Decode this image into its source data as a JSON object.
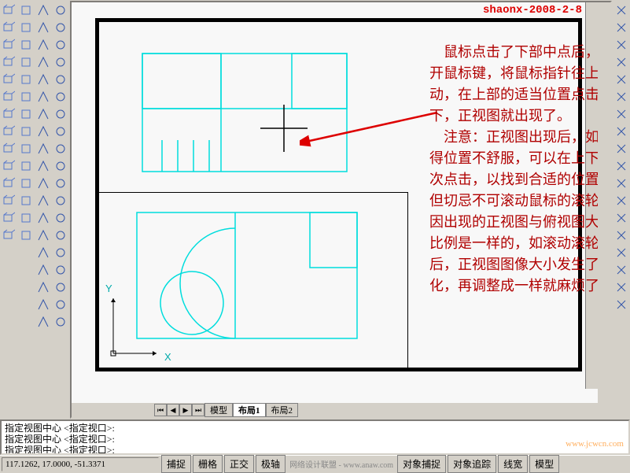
{
  "watermark_tr": "shaonx-2008-2-8",
  "watermark_br": "www.jcwcn.com",
  "axes": {
    "x": "X",
    "y": "Y"
  },
  "tabs": {
    "model": "模型",
    "layout1": "布局1",
    "layout2": "布局2"
  },
  "cmdline": {
    "line1": "指定视图中心 <指定视口>:",
    "line2": "指定视图中心 <指定视口>:",
    "line3": "指定视图中心 <指定视口>:"
  },
  "coords": "117.1262, 17.0000, -51.3371",
  "status_buttons": {
    "snap": "捕捉",
    "grid": "栅格",
    "ortho": "正交",
    "polar": "极轴",
    "osnap": "对象捕捉",
    "otrack": "对象追踪",
    "lwt": "线宽",
    "model": "模型"
  },
  "credit": "网络设计联盟 - www.anaw.com",
  "annotation": {
    "p1": "　鼠标点击了下部中点后，松开鼠标键，将鼠标指针往上移动，在上部的适当位置点击一下，正视图就出现了。",
    "p2": "　注意：正视图出现后，如觉得位置不舒服，可以在上下多次点击，以找到合适的位置，但切忌不可滚动鼠标的滚轮，因出现的正视图与俯视图大小比例是一样的，如滚动滚轮后，正视图图像大小发生了变化，再调整成一样就麻烦了。"
  },
  "toolbar_icons": {
    "l1": [
      "box",
      "wedge",
      "cone",
      "sphere",
      "cylinder",
      "torus",
      "extrude",
      "revolve",
      "slice",
      "section",
      "interfere",
      "setup-draw",
      "setup-view",
      "setup-profile"
    ],
    "l2": [
      "box3d",
      "wedge3d",
      "pyramid",
      "cylinder3d",
      "cone3d",
      "sphere3d",
      "dome",
      "dish",
      "torus3d",
      "mesh",
      "3dface",
      "edge",
      "revolved",
      "tabulated",
      "ruled",
      "edgemesh"
    ],
    "l3": [
      "line",
      "construction",
      "polyline",
      "polygon",
      "rectangle",
      "arc",
      "circle",
      "revcloud",
      "spline",
      "ellipse",
      "ellipse-arc",
      "insert",
      "block",
      "point",
      "hatch",
      "gradient",
      "region",
      "table",
      "text"
    ],
    "l4": [
      "solids-edit1",
      "solids-edit2",
      "solids-edit3",
      "solids-edit4",
      "solids-edit5",
      "solids-edit6",
      "solids-edit7",
      "solids-edit8",
      "solids-edit9",
      "solids-edit10",
      "union",
      "subtract",
      "intersect"
    ],
    "r": [
      "line-r",
      "xline",
      "pline-r",
      "polygon-r",
      "rect-r",
      "arc-r",
      "circle-r",
      "cloud",
      "spline-r",
      "ellipse-r",
      "earc",
      "insert-r",
      "make",
      "hatch-r",
      "gradient-r",
      "region-r",
      "table-r",
      "mtext"
    ]
  }
}
